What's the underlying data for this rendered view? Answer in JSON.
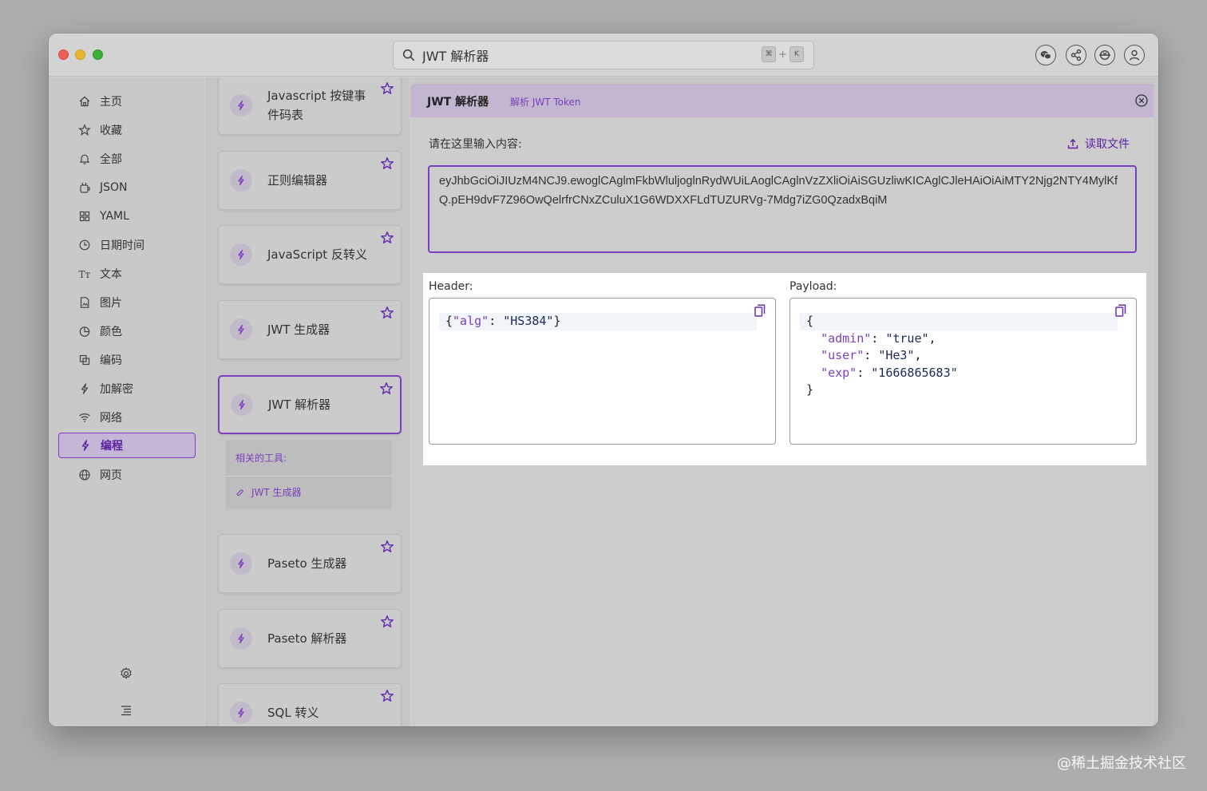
{
  "titlebar": {
    "search_value": "JWT 解析器",
    "shortcut_keys": [
      "⌘",
      "K"
    ],
    "shortcut_separator": "+"
  },
  "sidebar": {
    "items": [
      {
        "label": "主页",
        "icon": "home-icon"
      },
      {
        "label": "收藏",
        "icon": "star-icon"
      },
      {
        "label": "全部",
        "icon": "bell-icon"
      },
      {
        "label": "JSON",
        "icon": "json-icon"
      },
      {
        "label": "YAML",
        "icon": "grid-icon"
      },
      {
        "label": "日期时间",
        "icon": "clock-icon"
      },
      {
        "label": "文本",
        "icon": "text-icon"
      },
      {
        "label": "图片",
        "icon": "image-icon"
      },
      {
        "label": "颜色",
        "icon": "palette-icon"
      },
      {
        "label": "编码",
        "icon": "copy-icon"
      },
      {
        "label": "加解密",
        "icon": "bolt-icon"
      },
      {
        "label": "网络",
        "icon": "wifi-icon"
      },
      {
        "label": "编程",
        "icon": "bolt-icon"
      },
      {
        "label": "网页",
        "icon": "globe-icon"
      }
    ],
    "active_item": "编程"
  },
  "tools": {
    "cards": [
      {
        "label": "Javascript 按键事件码表"
      },
      {
        "label": "正则编辑器"
      },
      {
        "label": "JavaScript 反转义"
      },
      {
        "label": "JWT 生成器"
      },
      {
        "label": "JWT 解析器"
      },
      {
        "label": "Paseto 生成器"
      },
      {
        "label": "Paseto 解析器"
      },
      {
        "label": "SQL 转义"
      }
    ],
    "active_card": "JWT 解析器",
    "related": {
      "title": "相关的工具:",
      "link": "JWT 生成器"
    }
  },
  "main": {
    "title": "JWT 解析器",
    "subtitle": "解析 JWT Token",
    "prompt_label": "请在这里输入内容:",
    "read_file_label": "读取文件",
    "token_value": "eyJhbGciOiJIUzM4NCJ9.ewoglCAglmFkbWluljoglnRydWUiLAoglCAglnVzZXliOiAiSGUzliwKICAglCJleHAiOiAiMTY2Njg2NTY4MylKfQ.pEH9dvF7Z96OwQelrfrCNxZCuluX1G6WDXXFLdTUZURVg-7Mdg7iZG0QzadxBqiM",
    "header": {
      "label": "Header:",
      "lines": [
        "{\"alg\": \"HS384\"}"
      ]
    },
    "payload": {
      "label": "Payload:",
      "lines": [
        "{",
        "  \"admin\": \"true\",",
        "  \"user\": \"He3\",",
        "  \"exp\": \"1666865683\"",
        "}"
      ]
    }
  },
  "watermark": "@稀土掘金技术社区",
  "colors": {
    "accent": "#7b3fbf",
    "accent_dark": "#5a23a0",
    "header_bg": "#c2b6d0"
  }
}
